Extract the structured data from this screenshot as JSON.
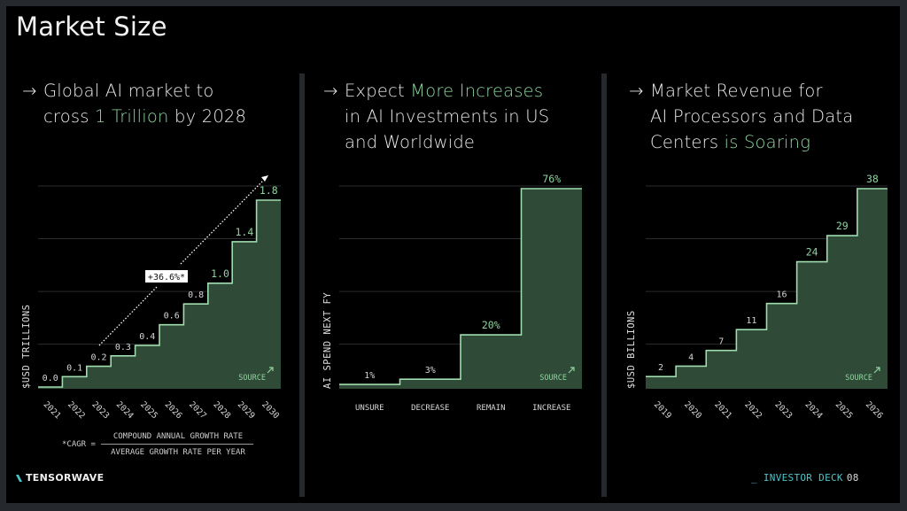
{
  "page": {
    "title": "Market Size",
    "footer": {
      "logo_text": "TENSORWAVE",
      "deck_prefix": "_ INVESTOR DECK",
      "page_number": "08"
    },
    "colors": {
      "frame": "#25282c",
      "background": "#000000",
      "accent_green": "#8fd4a0",
      "fill_green": "#2f4a36",
      "line_green": "#9fdcae",
      "teal": "#4ec3c9"
    }
  },
  "panels": [
    {
      "arrow": "→",
      "headline_lines": [
        [
          {
            "text": "Global AI market to",
            "highlight": false
          }
        ],
        [
          {
            "text": "cross ",
            "highlight": false
          },
          {
            "text": "1 Trillion",
            "highlight": true
          },
          {
            "text": " by 2028",
            "highlight": false
          }
        ]
      ],
      "source_label": "SOURCE",
      "cagr_label": "+36.6%*",
      "footnote": {
        "lhs": "*CAGR =",
        "numerator": "COMPOUND ANNUAL GROWTH RATE",
        "denominator": "AVERAGE GROWTH RATE PER YEAR"
      }
    },
    {
      "arrow": "→",
      "headline_lines": [
        [
          {
            "text": "Expect ",
            "highlight": false
          },
          {
            "text": "More Increases",
            "highlight": true
          }
        ],
        [
          {
            "text": "in AI Investments in US",
            "highlight": false
          }
        ],
        [
          {
            "text": "and Worldwide",
            "highlight": false
          }
        ]
      ],
      "source_label": "SOURCE"
    },
    {
      "arrow": "→",
      "headline_lines": [
        [
          {
            "text": "Market Revenue for",
            "highlight": false
          }
        ],
        [
          {
            "text": "AI Processors and Data",
            "highlight": false
          }
        ],
        [
          {
            "text": "Centers ",
            "highlight": false
          },
          {
            "text": "is Soaring",
            "highlight": true
          }
        ]
      ],
      "source_label": "SOURCE"
    }
  ],
  "chart_data": [
    {
      "type": "area",
      "subtype": "step",
      "title": "Global AI market to cross 1 Trillion by 2028",
      "xlabel": "",
      "ylabel": "$USD TRILLIONS",
      "categories": [
        "2021",
        "2022",
        "2023",
        "2024",
        "2025",
        "2026",
        "2027",
        "2028",
        "2029",
        "2030"
      ],
      "values": [
        0.0,
        0.1,
        0.2,
        0.3,
        0.4,
        0.6,
        0.8,
        1.0,
        1.4,
        1.8
      ],
      "data_labels": [
        "0.0",
        "0.1",
        "0.2",
        "0.3",
        "0.4",
        "0.6",
        "0.8",
        "1.0",
        "1.4",
        "1.8"
      ],
      "highlighted_from_index": 7,
      "ylim": [
        0,
        2.0
      ],
      "grid": true,
      "annotation": {
        "text": "+36.6%*",
        "kind": "dotted trend arrow"
      },
      "x_tick_rotation": "45deg"
    },
    {
      "type": "area",
      "subtype": "step",
      "title": "Expect More Increases in AI Investments in US and Worldwide",
      "xlabel": "",
      "ylabel": "AI SPEND NEXT FY",
      "categories": [
        "UNSURE",
        "DECREASE",
        "REMAIN",
        "INCREASE"
      ],
      "values": [
        1,
        3,
        20,
        76
      ],
      "data_labels": [
        "1%",
        "3%",
        "20%",
        "76%"
      ],
      "highlighted_from_index": 2,
      "ylim": [
        0,
        80
      ],
      "grid": true
    },
    {
      "type": "area",
      "subtype": "step",
      "title": "Market Revenue for AI Processors and Data Centers is Soaring",
      "xlabel": "",
      "ylabel": "$USD BILLIONS",
      "categories": [
        "2019",
        "2020",
        "2021",
        "2022",
        "2023",
        "2024",
        "2025",
        "2026"
      ],
      "values": [
        2,
        4,
        7,
        11,
        16,
        24,
        29,
        38
      ],
      "data_labels": [
        "2",
        "4",
        "7",
        "11",
        "16",
        "24",
        "29",
        "38"
      ],
      "highlighted_from_index": 5,
      "ylim": [
        0,
        40
      ],
      "grid": true,
      "x_tick_rotation": "45deg"
    }
  ]
}
